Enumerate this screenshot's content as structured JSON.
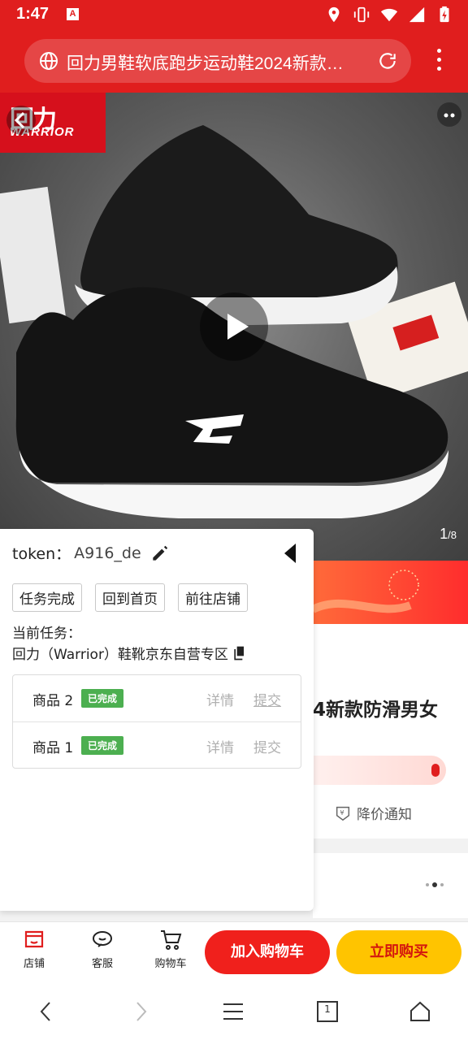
{
  "status_bar": {
    "time": "1:47",
    "app_badge": "A"
  },
  "browser": {
    "url_title": "回力男鞋软底跑步运动鞋2024新款…"
  },
  "product_image": {
    "brand_cn": "回力",
    "brand_en": "WARRIOR",
    "counter_current": "1",
    "counter_total": "/8"
  },
  "product_info": {
    "title_fragment": "4新款防滑男女",
    "price_alert": "降价通知"
  },
  "panel": {
    "token_label": "token：",
    "token_value": "A916_de",
    "buttons": [
      "任务完成",
      "回到首页",
      "前往店铺"
    ],
    "current_task_label": "当前任务：",
    "current_task_name": "回力（Warrior）鞋靴京东自营专区",
    "tasks": [
      {
        "name": "商品 2",
        "status": "已完成",
        "detail": "详情",
        "submit": "提交"
      },
      {
        "name": "商品 1",
        "status": "已完成",
        "detail": "详情",
        "submit": "提交"
      }
    ]
  },
  "bottom_bar": {
    "store": "店铺",
    "service": "客服",
    "cart": "购物车",
    "add_to_cart": "加入购物车",
    "buy_now": "立即购买"
  },
  "nav": {
    "tab_count": "1"
  },
  "colors": {
    "brand_red": "#e01e1e",
    "buy_yellow": "#ffc400",
    "done_green": "#4caf50"
  }
}
